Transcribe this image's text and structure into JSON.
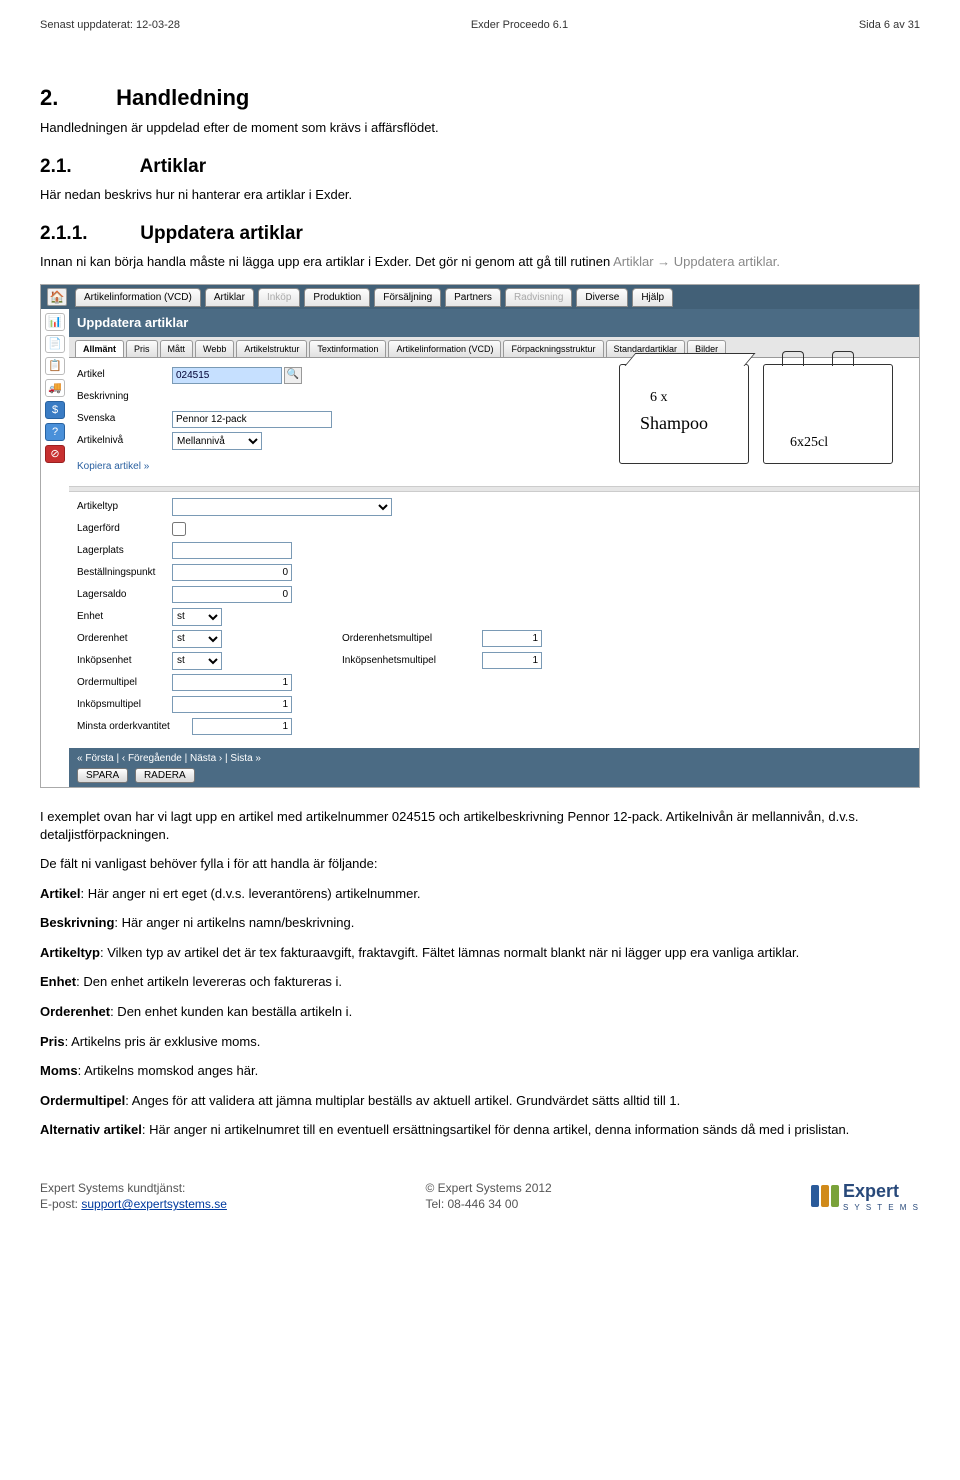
{
  "doc": {
    "updated": "Senast uppdaterat: 12-03-28",
    "title": "Exder Proceedo 6.1",
    "page_of": "Sida 6 av 31"
  },
  "section": {
    "num": "2.",
    "title": "Handledning",
    "intro": "Handledningen är uppdelad efter de moment som krävs i affärsflödet."
  },
  "sub1": {
    "num": "2.1.",
    "title": "Artiklar",
    "text": "Här nedan beskrivs hur ni hanterar era artiklar i Exder."
  },
  "sub2": {
    "num": "2.1.1.",
    "title": "Uppdatera artiklar",
    "text_a": "Innan ni kan börja handla måste ni lägga upp era artiklar i Exder. Det gör ni genom att gå till rutinen ",
    "text_link": "Artiklar → Uppdatera artiklar.",
    "text_b": ""
  },
  "app": {
    "top_tabs": [
      "Artikelinformation (VCD)",
      "Artiklar",
      "Inköp",
      "Produktion",
      "Försäljning",
      "Partners",
      "Radvisning",
      "Diverse",
      "Hjälp"
    ],
    "top_dim_idx": [
      2,
      6
    ],
    "panel_title": "Uppdatera artiklar",
    "sub_tabs": [
      "Allmänt",
      "Pris",
      "Mått",
      "Webb",
      "Artikelstruktur",
      "Textinformation",
      "Artikelinformation (VCD)",
      "Förpackningsstruktur",
      "Standardartiklar",
      "Bilder"
    ],
    "fields": {
      "artikel_lbl": "Artikel",
      "artikel_val": "024515",
      "beskrivning_lbl": "Beskrivning",
      "svenska_lbl": "Svenska",
      "svenska_val": "Pennor 12-pack",
      "niva_lbl": "Artikelnivå",
      "niva_val": "Mellannivå",
      "copy_link": "Kopiera artikel »",
      "illus_txt1": "6 x",
      "illus_txt2": "Shampoo",
      "illus_txt3": "6x25cl",
      "typ_lbl": "Artikeltyp",
      "lagerford_lbl": "Lagerförd",
      "lagerplats_lbl": "Lagerplats",
      "bestallpkt_lbl": "Beställningspunkt",
      "bestallpkt_val": "0",
      "lagersaldo_lbl": "Lagersaldo",
      "lagersaldo_val": "0",
      "enhet_lbl": "Enhet",
      "enhet_val": "st",
      "orderenhet_lbl": "Orderenhet",
      "orderenhet_val": "st",
      "orderenhetsmult_lbl": "Orderenhetsmultipel",
      "orderenhetsmult_val": "1",
      "inkopsenhet_lbl": "Inköpsenhet",
      "inkopsenhet_val": "st",
      "inkopsenhetsmult_lbl": "Inköpsenhetsmultipel",
      "inkopsenhetsmult_val": "1",
      "ordermultipel_lbl": "Ordermultipel",
      "ordermultipel_val": "1",
      "inkopsmultipel_lbl": "Inköpsmultipel",
      "inkopsmultipel_val": "1",
      "minsta_lbl": "Minsta orderkvantitet",
      "minsta_val": "1"
    },
    "nav": {
      "paging": "« Första  |  ‹ Föregående  |  Nästa ›  |  Sista »",
      "save": "SPARA",
      "delete": "RADERA"
    },
    "side_icons": [
      "📊",
      "📄",
      "📋",
      "🚚",
      "$",
      "?",
      "⊘"
    ]
  },
  "body": {
    "p1": "I exemplet ovan har vi lagt upp en artikel med artikelnummer 024515 och artikelbeskrivning Pennor 12-pack. Artikelnivån är mellannivån, d.v.s. detaljistförpackningen.",
    "p2": "De fält ni vanligast behöver fylla i för att handla är följande:",
    "artikel_t": "Artikel",
    "artikel_d": ": Här anger ni ert eget (d.v.s. leverantörens) artikelnummer.",
    "beskr_t": "Beskrivning",
    "beskr_d": ": Här anger ni artikelns namn/beskrivning.",
    "typ_t": "Artikeltyp",
    "typ_d": ": Vilken typ av artikel det är tex fakturaavgift, fraktavgift. Fältet lämnas normalt blankt när ni lägger upp era vanliga artiklar.",
    "enhet_t": "Enhet",
    "enhet_d": ": Den enhet artikeln levereras och faktureras i.",
    "orderenhet_t": "Orderenhet",
    "orderenhet_d": ": Den enhet kunden kan beställa artikeln i.",
    "pris_t": "Pris",
    "pris_d": ": Artikelns pris är exklusive moms.",
    "moms_t": "Moms",
    "moms_d": ": Artikelns momskod anges här.",
    "ordermult_t": "Ordermultipel",
    "ordermult_d": ": Anges för att validera att jämna multiplar beställs av aktuell artikel. Grundvärdet sätts alltid till 1.",
    "alt_t": "Alternativ artikel",
    "alt_d": ": Här anger ni artikelnumret till en eventuell ersättningsartikel för denna artikel, denna information sänds då med i prislistan."
  },
  "footer": {
    "left1": "Expert Systems kundtjänst:",
    "left2_a": "E-post: ",
    "left2_link": "support@expertsystems.se",
    "mid1": "© Expert Systems 2012",
    "mid2": "Tel: 08-446 34 00",
    "logo_text": "Expert",
    "logo_sub": "S Y S T E M S"
  }
}
